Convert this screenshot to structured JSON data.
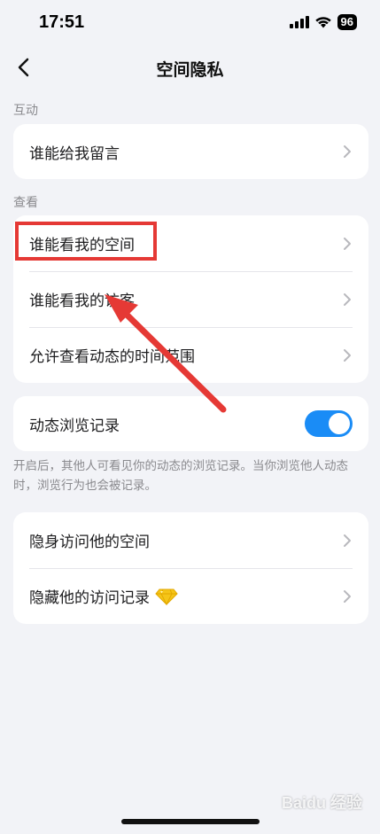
{
  "status_bar": {
    "time": "17:51",
    "battery": "96"
  },
  "nav": {
    "title": "空间隐私"
  },
  "sections": {
    "interact": {
      "label": "互动",
      "items": [
        {
          "label": "谁能给我留言"
        }
      ]
    },
    "view": {
      "label": "查看",
      "items": [
        {
          "label": "谁能看我的空间"
        },
        {
          "label": "谁能看我的访客"
        },
        {
          "label": "允许查看动态的时间范围"
        }
      ]
    },
    "browse": {
      "label": "动态浏览记录",
      "toggle_on": true,
      "hint": "开启后，其他人可看见你的动态的浏览记录。当你浏览他人动态时，浏览行为也会被记录。"
    },
    "stealth": {
      "items": [
        {
          "label": "隐身访问他的空间"
        },
        {
          "label": "隐藏他的访问记录"
        }
      ]
    }
  },
  "watermark": "Baidu 经验",
  "colors": {
    "accent": "#1a8cf6",
    "annotation": "#e53935",
    "background": "#f2f3f7"
  }
}
